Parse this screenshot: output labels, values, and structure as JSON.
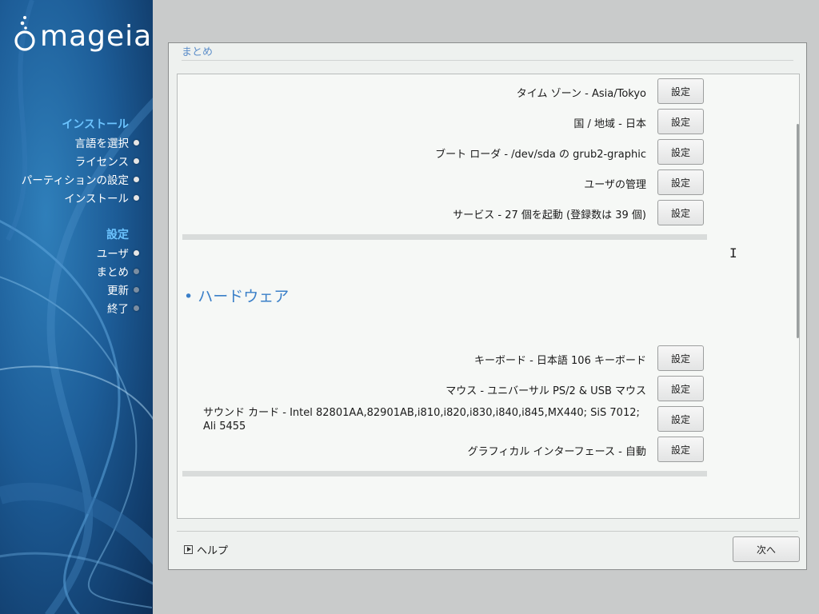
{
  "sidebar": {
    "logo_text": "mageia",
    "sections": [
      {
        "title": "インストール",
        "items": [
          {
            "label": "言語を選択",
            "state": "done"
          },
          {
            "label": "ライセンス",
            "state": "done"
          },
          {
            "label": "パーティションの設定",
            "state": "done"
          },
          {
            "label": "インストール",
            "state": "done"
          }
        ]
      },
      {
        "title": "設定",
        "items": [
          {
            "label": "ユーザ",
            "state": "done"
          },
          {
            "label": "まとめ",
            "state": "current"
          },
          {
            "label": "更新",
            "state": "pending"
          },
          {
            "label": "終了",
            "state": "pending"
          }
        ]
      }
    ]
  },
  "panel": {
    "title": "まとめ",
    "system_rows": [
      {
        "label": "タイム ゾーン - Asia/Tokyo",
        "button": "設定"
      },
      {
        "label": "国 / 地域 - 日本",
        "button": "設定"
      },
      {
        "label": "ブート ローダ - /dev/sda の grub2-graphic",
        "button": "設定"
      },
      {
        "label": "ユーザの管理",
        "button": "設定"
      },
      {
        "label": "サービス - 27 個を起動 (登録数は 39 個)",
        "button": "設定"
      }
    ],
    "hardware_heading": "• ハードウェア",
    "hardware_rows": [
      {
        "label": "キーボード - 日本語 106 キーボード",
        "button": "設定"
      },
      {
        "label": "マウス - ユニバーサル PS/2 & USB マウス",
        "button": "設定"
      },
      {
        "label": "サウンド カード - Intel 82801AA,82901AB,i810,i820,i830,i840,i845,MX440; SiS 7012; Ali 5455",
        "button": "設定"
      },
      {
        "label": "グラフィカル インターフェース - 自動",
        "button": "設定"
      }
    ]
  },
  "footer": {
    "help_label": "ヘルプ",
    "next_label": "次へ"
  },
  "colors": {
    "sidebar_section": "#6cc4ff",
    "panel_title": "#5c8ec9",
    "heading": "#3a7fc8"
  }
}
